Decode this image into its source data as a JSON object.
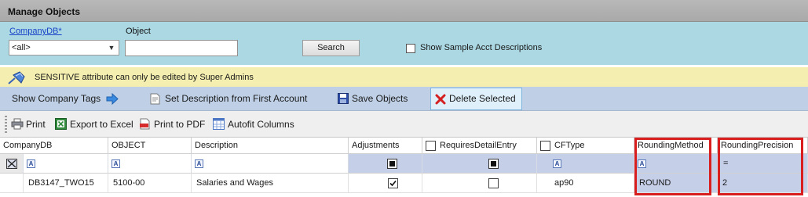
{
  "window": {
    "title": "Manage Objects"
  },
  "filter": {
    "company_label": "CompanyDB*",
    "company_value": "<all>",
    "object_label": "Object",
    "object_value": "",
    "search_label": "Search",
    "sample_label": "Show Sample Acct Descriptions",
    "sample_checked": false
  },
  "notice": {
    "text": "SENSITIVE attribute can only be edited by Super Admins"
  },
  "actions": {
    "show_tags": "Show Company Tags",
    "set_description": "Set Description from First Account",
    "save": "Save Objects",
    "delete": "Delete Selected"
  },
  "toolbar": {
    "print": "Print",
    "export_excel": "Export to Excel",
    "print_pdf": "Print to PDF",
    "autofit": "Autofit Columns"
  },
  "grid": {
    "columns": [
      "CompanyDB",
      "OBJECT",
      "Description",
      "Adjustments",
      "RequiresDetailEntry",
      "CFType",
      "RoundingMethod",
      "RoundingPrecision"
    ],
    "filter_equals": "=",
    "rows": [
      {
        "company": "DB3147_TWO15",
        "object": "5100-00",
        "description": "Salaries and Wages",
        "adjustments": true,
        "requires_detail": false,
        "cftype": "ap90",
        "rounding_method": "ROUND",
        "rounding_precision": "2"
      }
    ]
  },
  "colors": {
    "highlight": "#d81e1e",
    "selected_column": "#c5cfe8",
    "filter_bar": "#abd8e3",
    "notice_bar": "#f4efb0",
    "action_bar": "#bfd0e6"
  }
}
